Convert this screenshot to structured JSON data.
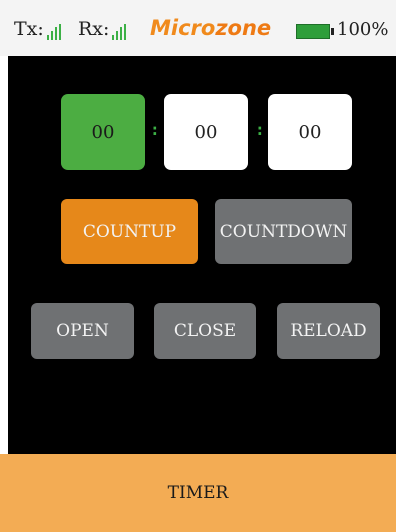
{
  "status": {
    "tx_label": "Tx:",
    "rx_label": "Rx:",
    "brand_part1": "Micro",
    "brand_part2": "zone",
    "battery_percent": "100%",
    "battery_level": 1.0
  },
  "timer": {
    "hours": "00",
    "minutes": "00",
    "seconds": "00",
    "separator": ":"
  },
  "mode_buttons": {
    "countup": "COUNTUP",
    "countdown": "COUNTDOWN"
  },
  "action_buttons": {
    "open": "OPEN",
    "close": "CLOSE",
    "reload": "RELOAD"
  },
  "footer": {
    "title": "TIMER"
  },
  "colors": {
    "active_orange": "#e6881a",
    "inactive_gray": "#6f7173",
    "timer_green": "#4cad42",
    "footer_bg": "#f3ac54",
    "signal_green": "#3cb046"
  }
}
